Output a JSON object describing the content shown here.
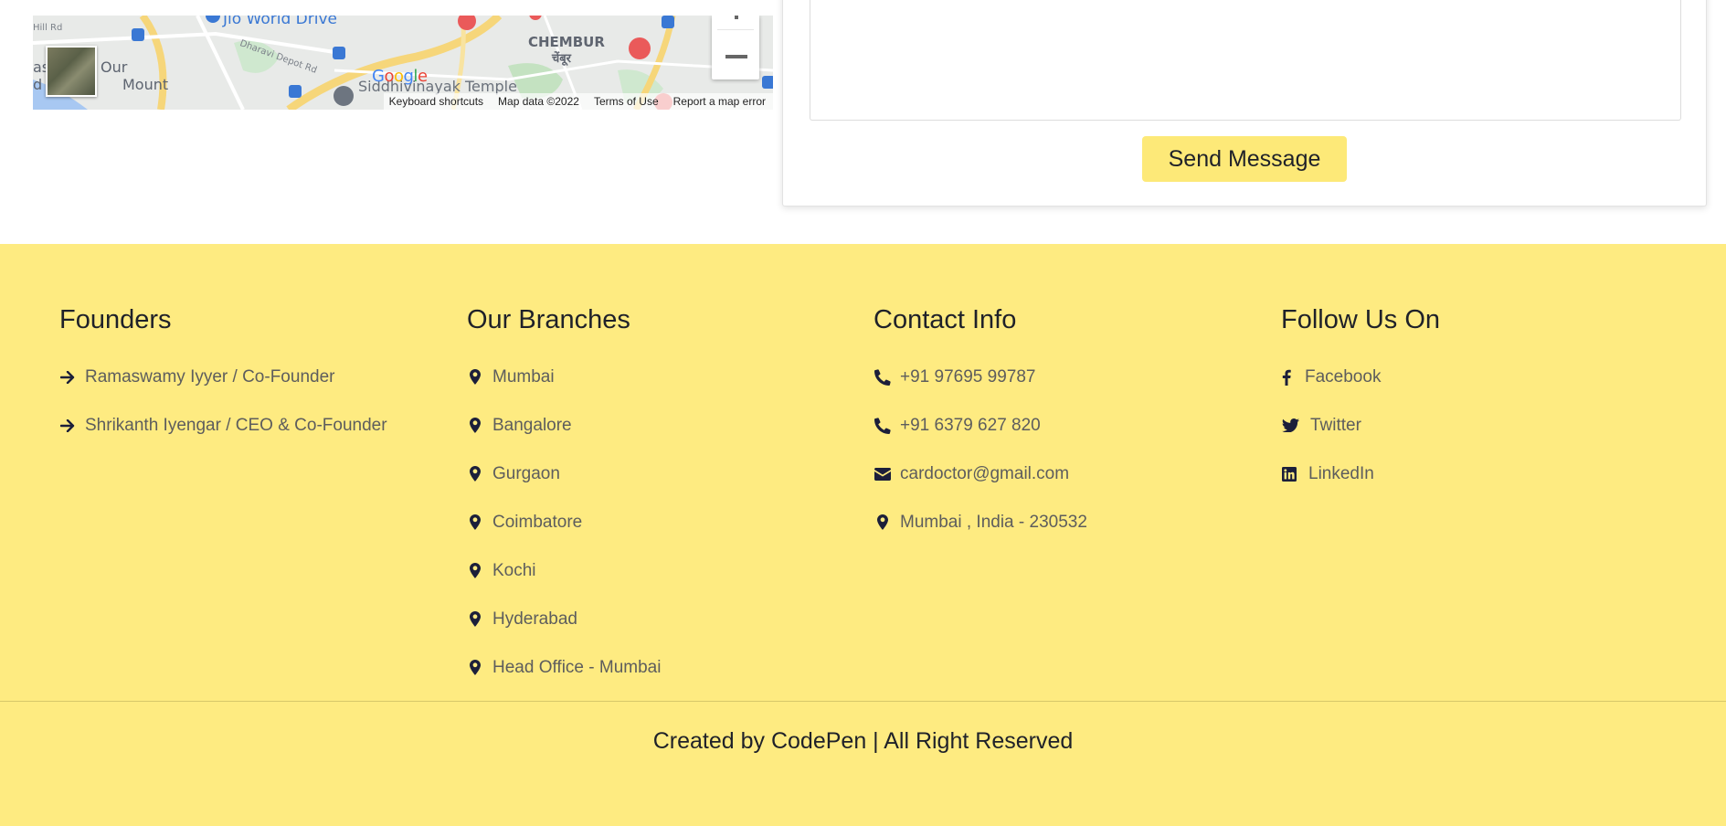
{
  "map": {
    "labels": {
      "road": "Hill Rd",
      "place1": "Jio World Drive",
      "place2": "CHEMBUR",
      "place2_local": "चेंबूर",
      "place3": "Our",
      "place4": "Mount",
      "place5_prefix": "as",
      "place6_prefix": "d",
      "temple": "Siddhivinayak Temple",
      "depot": "Dharavi Depot Rd"
    },
    "logo": "Google",
    "attribution": {
      "shortcuts": "Keyboard shortcuts",
      "data": "Map data ©2022",
      "terms": "Terms of Use",
      "report": "Report a map error"
    }
  },
  "contact_form": {
    "send_label": "Send Message"
  },
  "footer": {
    "founders": {
      "title": "Founders",
      "items": [
        "Ramaswamy Iyyer / Co-Founder",
        "Shrikanth Iyengar / CEO & Co-Founder"
      ]
    },
    "branches": {
      "title": "Our Branches",
      "items": [
        "Mumbai",
        "Bangalore",
        "Gurgaon",
        "Coimbatore",
        "Kochi",
        "Hyderabad",
        "Head Office - Mumbai"
      ]
    },
    "contact": {
      "title": "Contact Info",
      "phone1": "+91 97695 99787",
      "phone2": "+91 6379 627 820",
      "email": "cardoctor@gmail.com",
      "address": "Mumbai , India - 230532"
    },
    "social": {
      "title": "Follow Us On",
      "facebook": "Facebook",
      "twitter": "Twitter",
      "linkedin": "LinkedIn"
    },
    "copyright": "Created by CodePen | All Right Reserved"
  },
  "colors": {
    "footer_bg": "#feeb81",
    "button_bg": "#fde978",
    "icon": "#1c1f3a"
  }
}
